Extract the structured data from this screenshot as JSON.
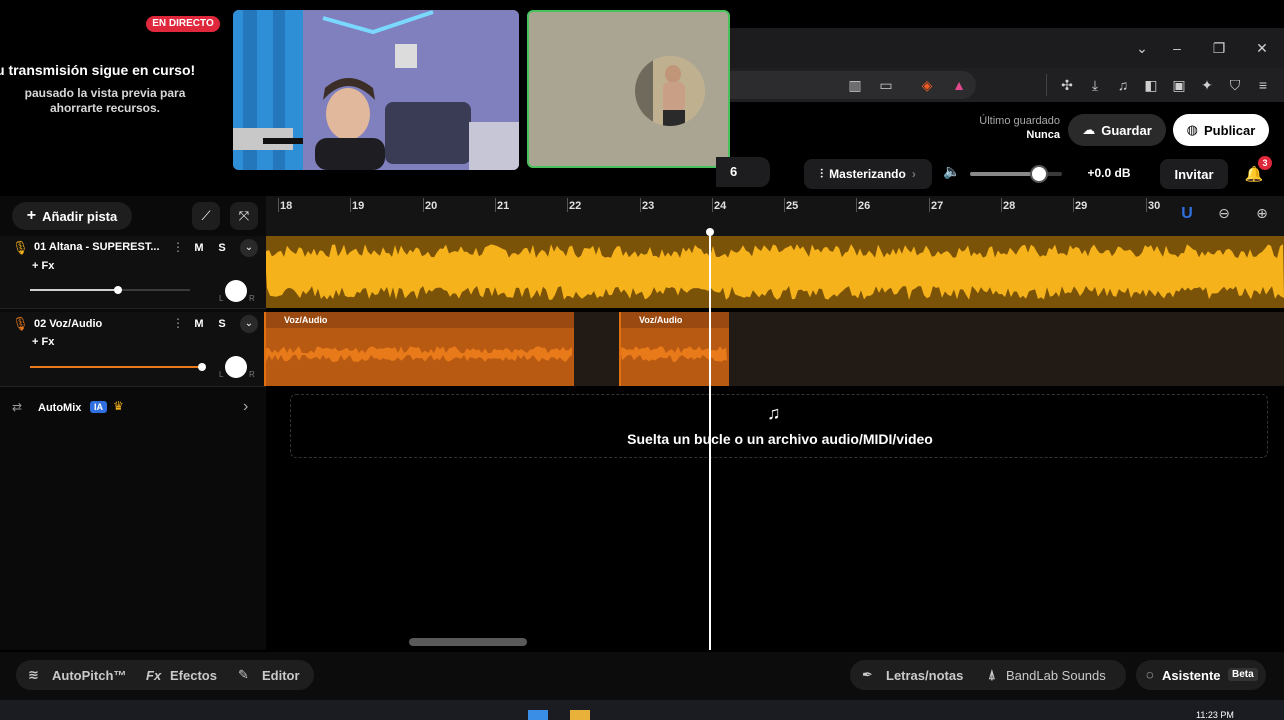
{
  "stream": {
    "live_badge": "EN DIRECTO",
    "title": "u transmisión sigue en curso!",
    "subtitle": "pausado la vista previa para ahorrarte recursos."
  },
  "header": {
    "saved_label": "Último guardado",
    "saved_value": "Nunca",
    "save_button": "Guardar",
    "publish_button": "Publicar"
  },
  "controls": {
    "tempo_partial": "6",
    "mastering": "Masterizando",
    "volume_db": "+0.0 dB",
    "invite": "Invitar",
    "notifications_count": "3",
    "master_volume": 0.75
  },
  "toolbar": {
    "add_track": "Añadir pista"
  },
  "ruler": {
    "marks": [
      "18",
      "19",
      "20",
      "21",
      "22",
      "23",
      "24",
      "25",
      "26",
      "27",
      "28",
      "29",
      "30"
    ]
  },
  "tracks": [
    {
      "name": "01  Altana - SUPEREST...",
      "mute": "M",
      "solo": "S",
      "fx": "+ Fx",
      "volume": 0.55,
      "pan_l": "L",
      "pan_r": "R",
      "color": "#f5b21a"
    },
    {
      "name": "02  Voz/Audio",
      "mute": "M",
      "solo": "S",
      "fx": "+ Fx",
      "volume": 1.0,
      "pan_l": "L",
      "pan_r": "R",
      "color": "#e87a1a",
      "clips": [
        "Voz/Audio",
        "Voz/Audio"
      ]
    }
  ],
  "automix": {
    "label": "AutoMix",
    "badge": "IA"
  },
  "drop_zone": {
    "text": "Suelta un bucle o un archivo audio/MIDI/video"
  },
  "bottom": {
    "autopitch": "AutoPitch™",
    "effects_prefix": "Fx",
    "effects": "Efectos",
    "editor": "Editor",
    "lyrics": "Letras/notas",
    "sounds": "BandLab Sounds",
    "assistant": "Asistente",
    "assistant_badge": "Beta"
  },
  "taskbar": {
    "time": "11:23 PM"
  },
  "colors": {
    "track1_wave": "#f5b21a",
    "track2_wave": "#e87a1a",
    "live_red": "#e0283c",
    "accent_blue": "#2f6fe0"
  }
}
